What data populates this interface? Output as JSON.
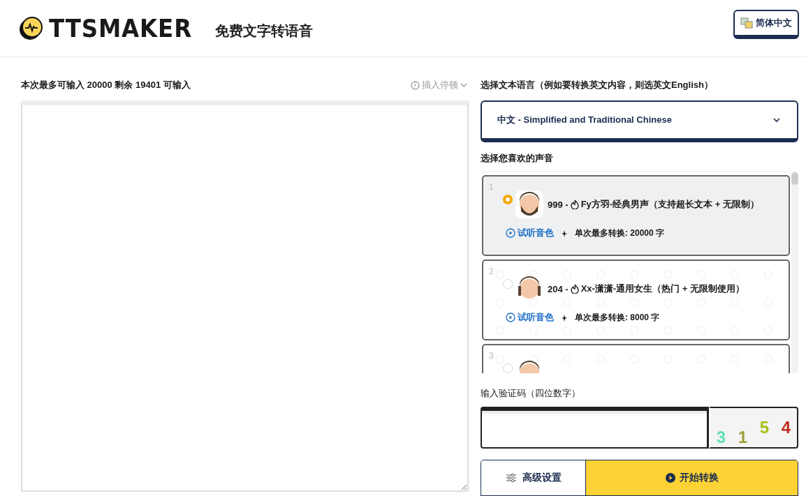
{
  "header": {
    "logo": "TTSMAKER",
    "tagline": "免费文字转语音",
    "language_button": "简体中文"
  },
  "editor": {
    "counter": "本次最多可输入 20000 剩余 19401 可输入",
    "pause_button": "插入停顿"
  },
  "language": {
    "label": "选择文本语言（例如要转换英文内容，则选英文English）",
    "value": "中文 - Simplified and Traditional Chinese"
  },
  "voices": {
    "label": "选择您喜欢的声音",
    "items": [
      {
        "index": "1",
        "id": "999 -",
        "name": "Fy方羽-经典男声（支持超长文本 + 无限制）",
        "listen": "试听音色",
        "limit": "单次最多转换: 20000 字",
        "selected": true,
        "kind": "man"
      },
      {
        "index": "2",
        "id": "204 -",
        "name": "Xx-潇潇-通用女生（热门 + 无限制使用）",
        "listen": "试听音色",
        "limit": "单次最多转换: 8000 字",
        "selected": false,
        "kind": "woman"
      },
      {
        "index": "3",
        "selected": false,
        "kind": "boy"
      }
    ]
  },
  "captcha": {
    "label": "输入验证码（四位数字）",
    "digits": [
      {
        "text": "3",
        "color": "#5fe0b8"
      },
      {
        "text": "1",
        "color": "#a0a040"
      },
      {
        "text": "5",
        "color": "#a8c018"
      },
      {
        "text": "4",
        "color": "#c03020"
      }
    ]
  },
  "buttons": {
    "settings": "高级设置",
    "convert": "开始转换"
  }
}
